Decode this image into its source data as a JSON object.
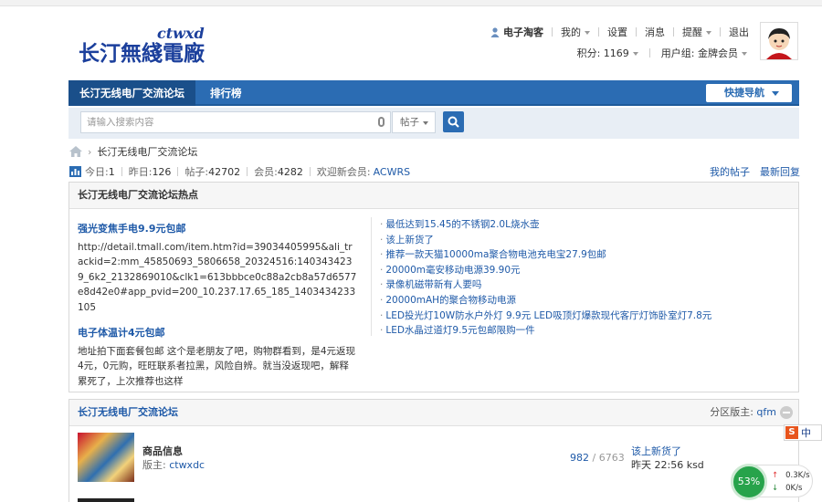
{
  "logo": {
    "cn": "长汀無綫電廠",
    "en": "ctwxd"
  },
  "userbar": {
    "username": "电子淘客",
    "items": [
      "我的",
      "设置",
      "消息",
      "提醒",
      "退出"
    ],
    "points_label": "积分: 1169",
    "group_label": "用户组: 金牌会员"
  },
  "nav": {
    "tabs": [
      "长汀无线电厂交流论坛",
      "排行榜"
    ],
    "quick_nav": "快捷导航"
  },
  "search": {
    "placeholder": "请输入搜索内容",
    "type": "帖子"
  },
  "breadcrumb": {
    "current": "长汀无线电厂交流论坛"
  },
  "stats": {
    "today_label": "今日: ",
    "today": "1",
    "yesterday_label": "昨日: ",
    "yesterday": "126",
    "posts_label": "帖子: ",
    "posts": "42702",
    "members_label": "会员: ",
    "members": "4282",
    "welcome_label": "欢迎新会员: ",
    "new_member": "ACWRS",
    "my_posts": "我的帖子",
    "latest_reply": "最新回复"
  },
  "hot": {
    "title": "长汀无线电厂交流论坛热点",
    "left": [
      {
        "title": "强光变焦手电9.9元包邮",
        "text": "http://detail.tmall.com/item.htm?id=39034405995&ali_trackid=2:mm_45850693_5806658_20324516:1403434239_6k2_2132869010&clk1=613bbbce0c88a2cb8a57d6577e8d42e0#app_pvid=200_10.237.17.65_185_1403434233105"
      },
      {
        "title": "电子体温计4元包邮",
        "text": "地址拍下面套餐包邮 这个是老朋友了吧，购物群看到，是4元返现4元，0元购，旺旺联系者拉黑，风险自辨。就当没返现吧，解释累死了，上次推荐也这样"
      }
    ],
    "right": [
      "最低达到15.45的不锈钢2.0L烧水壶",
      "该上新货了",
      "推荐一款天猫10000ma聚合物电池充电宝27.9包邮",
      "20000m毫安移动电源39.90元",
      "录像机磁带新有人要吗",
      "20000mAH的聚合物移动电源",
      "LED投光灯10W防水户外灯 9.9元 LED吸顶灯爆款现代客厅灯饰卧室灯7.8元",
      "LED水晶过道灯9.5元包邮限购一件"
    ]
  },
  "forum": {
    "title": "长汀无线电厂交流论坛",
    "moderator_label": "分区版主: ",
    "moderator": "qfm",
    "rows": [
      {
        "name": "商品信息",
        "mod_label": "版主: ",
        "mod": "ctwxdc",
        "threads": "982",
        "posts": "6763",
        "last_title": "该上新货了",
        "last_time": "昨天 22:56 ksd"
      }
    ]
  },
  "ime": {
    "label": "中"
  },
  "netwidget": {
    "percent": "53%",
    "up": "0.3K/s",
    "down": "0K/s"
  }
}
